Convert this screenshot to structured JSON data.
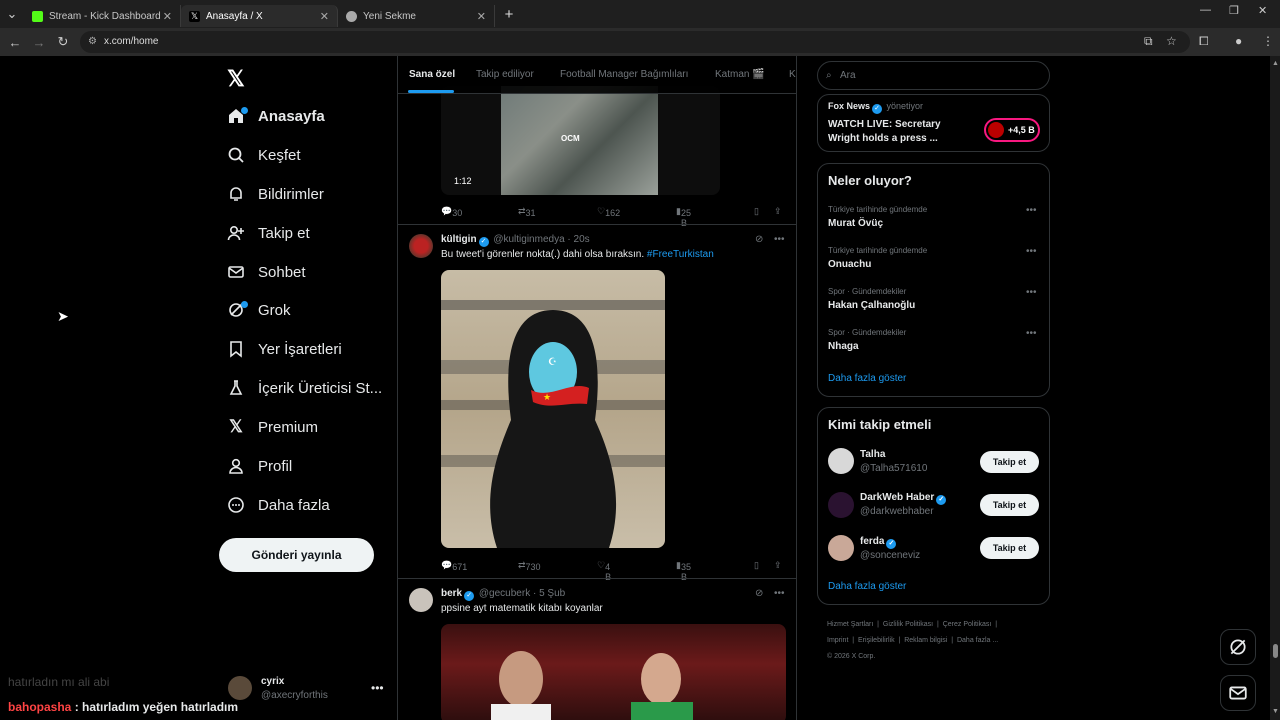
{
  "browser": {
    "tabs": [
      {
        "title": "Stream - Kick Dashboard",
        "favicon_color": "#53fc18"
      },
      {
        "title": "Anasayfa / X",
        "favicon_color": "#000000"
      },
      {
        "title": "Yeni Sekme",
        "favicon_color": "#aaaaaa"
      }
    ],
    "url": "x.com/home"
  },
  "nav": {
    "items": [
      {
        "label": "Anasayfa",
        "icon": "home-icon"
      },
      {
        "label": "Keşfet",
        "icon": "search-icon"
      },
      {
        "label": "Bildirimler",
        "icon": "bell-icon"
      },
      {
        "label": "Takip et",
        "icon": "add-user-icon"
      },
      {
        "label": "Sohbet",
        "icon": "mail-icon"
      },
      {
        "label": "Grok",
        "icon": "grok-icon"
      },
      {
        "label": "Yer İşaretleri",
        "icon": "bookmark-icon"
      },
      {
        "label": "İçerik Üreticisi St...",
        "icon": "creator-studio-icon"
      },
      {
        "label": "Premium",
        "icon": "x-icon"
      },
      {
        "label": "Profil",
        "icon": "profile-icon"
      },
      {
        "label": "Daha fazla",
        "icon": "more-circle-icon"
      }
    ],
    "post_button": "Gönderi yayınla",
    "account": {
      "name": "cyrix",
      "handle": "@axecryforthis"
    }
  },
  "overlay": {
    "chat_faded": "hatırladın mı ali abi",
    "chat_user": "bahopasha",
    "chat_msg": " : hatırladım yeğen hatırladım"
  },
  "timeline": {
    "tabs": [
      "Sana özel",
      "Takip ediliyor",
      "Football Manager Bağımlıları",
      "Katman 🎬",
      "Ka"
    ],
    "post0": {
      "media_logo": "OCM",
      "duration": "1:12",
      "replies": "30",
      "reposts": "31",
      "likes": "162",
      "views": "25 B"
    },
    "post1": {
      "name": "kültigin",
      "handle": "@kultiginmedya",
      "time": "· 20s",
      "text": "Bu tweet'i görenler nokta(.) dahi olsa bıraksın.",
      "hashtag": "#FreeTurkistan",
      "replies": "671",
      "reposts": "730",
      "likes": "4 B",
      "views": "35 B"
    },
    "post2": {
      "name": "berk",
      "handle": "@gecuberk",
      "time": "· 5 Şub",
      "text": "ppsine ayt matematik kitabı koyanlar"
    }
  },
  "sidebar": {
    "search_placeholder": "Ara",
    "live": {
      "source": "Fox News",
      "managing": "yönetiyor",
      "title_line1": "WATCH LIVE: Secretary",
      "title_line2": "Wright holds a press ...",
      "viewers": "+4,5 B"
    },
    "trends_title": "Neler oluyor?",
    "trends": [
      {
        "context": "Türkiye tarihinde gündemde",
        "name": "Murat Övüç"
      },
      {
        "context": "Türkiye tarihinde gündemde",
        "name": "Onuachu"
      },
      {
        "context": "Spor · Gündemdekiler",
        "name": "Hakan Çalhanoğlu"
      },
      {
        "context": "Spor · Gündemdekiler",
        "name": "Nhaga"
      }
    ],
    "show_more": "Daha fazla göster",
    "who_title": "Kimi takip etmeli",
    "who": [
      {
        "name": "Talha",
        "handle": "@Talha571610",
        "verified": false,
        "avatar_color": "#d8d8d8"
      },
      {
        "name": "DarkWeb Haber",
        "handle": "@darkwebhaber",
        "verified": true,
        "avatar_color": "#2a1230"
      },
      {
        "name": "ferda",
        "handle": "@sonceneviz",
        "verified": true,
        "avatar_color": "#c9a898"
      }
    ],
    "follow_label": "Takip et",
    "footer": [
      "Hizmet Şartları",
      "Gizlilik Politikası",
      "Çerez Politikası",
      "Imprint",
      "Erişilebilirlik",
      "Reklam bilgisi",
      "Daha fazla ...",
      "© 2026 X Corp."
    ]
  }
}
